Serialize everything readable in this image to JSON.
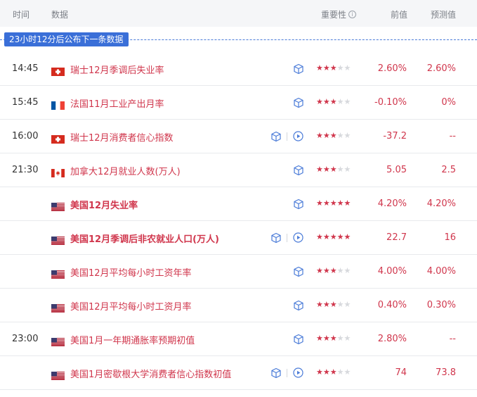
{
  "header": {
    "time": "时间",
    "data": "数据",
    "importance": "重要性",
    "importance_icon": "i",
    "previous": "前值",
    "forecast": "预测值"
  },
  "countdown": "23小时12分后公布下一条数据",
  "colors": {
    "accent": "#d0364c",
    "countdown_bg": "#3a6fd8",
    "header_bg": "#f5f6f8"
  },
  "rows": [
    {
      "time": "14:45",
      "flag": "switzerland-flag",
      "title": "瑞士12月季调后失业率",
      "bold": false,
      "stars": 3,
      "previous": "2.60%",
      "forecast": "2.60%",
      "has_play": false
    },
    {
      "time": "15:45",
      "flag": "france-flag",
      "title": "法国11月工业产出月率",
      "bold": false,
      "stars": 3,
      "previous": "-0.10%",
      "forecast": "0%",
      "has_play": false
    },
    {
      "time": "16:00",
      "flag": "switzerland-flag",
      "title": "瑞士12月消费者信心指数",
      "bold": false,
      "stars": 3,
      "previous": "-37.2",
      "forecast": "--",
      "has_play": true
    },
    {
      "time": "21:30",
      "flag": "canada-flag",
      "title": "加拿大12月就业人数(万人)",
      "bold": false,
      "stars": 3,
      "previous": "5.05",
      "forecast": "2.5",
      "has_play": false
    },
    {
      "time": "",
      "flag": "usa-flag",
      "title": "美国12月失业率",
      "bold": true,
      "stars": 5,
      "previous": "4.20%",
      "forecast": "4.20%",
      "has_play": false
    },
    {
      "time": "",
      "flag": "usa-flag",
      "title": "美国12月季调后非农就业人口(万人)",
      "bold": true,
      "stars": 5,
      "previous": "22.7",
      "forecast": "16",
      "has_play": true
    },
    {
      "time": "",
      "flag": "usa-flag",
      "title": "美国12月平均每小时工资年率",
      "bold": false,
      "stars": 3,
      "previous": "4.00%",
      "forecast": "4.00%",
      "has_play": false
    },
    {
      "time": "",
      "flag": "usa-flag",
      "title": "美国12月平均每小时工资月率",
      "bold": false,
      "stars": 3,
      "previous": "0.40%",
      "forecast": "0.30%",
      "has_play": false
    },
    {
      "time": "23:00",
      "flag": "usa-flag",
      "title": "美国1月一年期通胀率预期初值",
      "bold": false,
      "stars": 3,
      "previous": "2.80%",
      "forecast": "--",
      "has_play": false
    },
    {
      "time": "",
      "flag": "usa-flag",
      "title": "美国1月密歇根大学消费者信心指数初值",
      "bold": false,
      "stars": 3,
      "previous": "74",
      "forecast": "73.8",
      "has_play": true
    }
  ]
}
